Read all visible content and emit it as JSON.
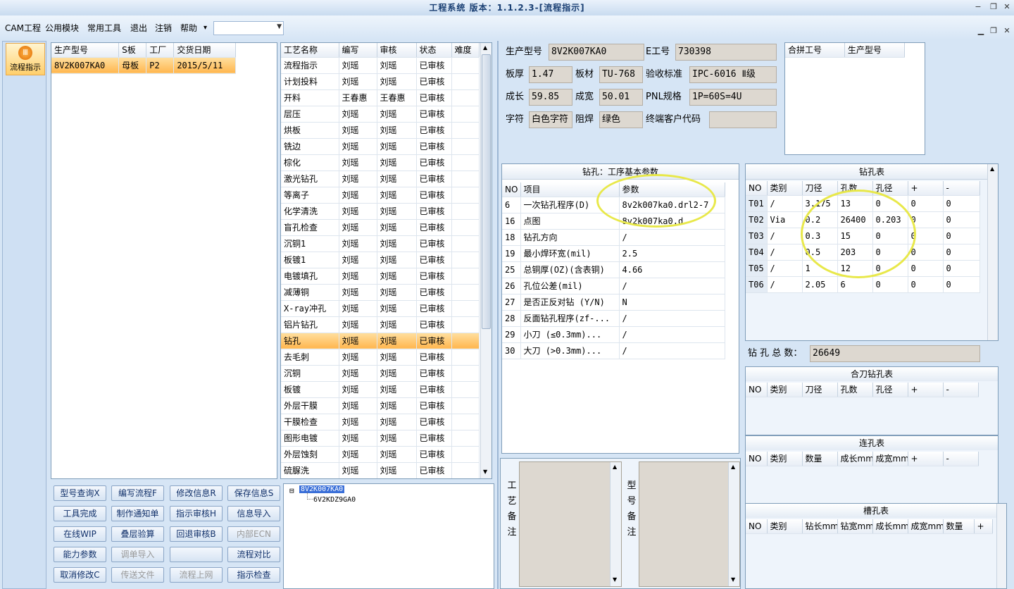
{
  "title": "工程系统 版本：1.1.2.3-[流程指示]",
  "menu": [
    "CAM工程",
    "公用模块",
    "常用工具",
    "退出",
    "注销",
    "帮助"
  ],
  "menu_arrow": "▾",
  "nav_button": "流程指示",
  "orders": {
    "headers": [
      "生产型号",
      "S板",
      "工厂",
      "交货日期"
    ],
    "rows": [
      [
        "8V2K007KA0",
        "母板",
        "P2",
        "2015/5/11"
      ]
    ]
  },
  "process": {
    "headers": [
      "工艺名称",
      "编写",
      "审核",
      "状态",
      "难度"
    ],
    "rows": [
      [
        "流程指示",
        "刘瑶",
        "刘瑶",
        "已审核",
        ""
      ],
      [
        "计划投料",
        "刘瑶",
        "刘瑶",
        "已审核",
        ""
      ],
      [
        "开料",
        "王春惠",
        "王春惠",
        "已审核",
        ""
      ],
      [
        "层压",
        "刘瑶",
        "刘瑶",
        "已审核",
        ""
      ],
      [
        "烘板",
        "刘瑶",
        "刘瑶",
        "已审核",
        ""
      ],
      [
        "铣边",
        "刘瑶",
        "刘瑶",
        "已审核",
        ""
      ],
      [
        "棕化",
        "刘瑶",
        "刘瑶",
        "已审核",
        ""
      ],
      [
        "激光钻孔",
        "刘瑶",
        "刘瑶",
        "已审核",
        ""
      ],
      [
        "等离子",
        "刘瑶",
        "刘瑶",
        "已审核",
        ""
      ],
      [
        "化学清洗",
        "刘瑶",
        "刘瑶",
        "已审核",
        ""
      ],
      [
        "盲孔检查",
        "刘瑶",
        "刘瑶",
        "已审核",
        ""
      ],
      [
        "沉铜1",
        "刘瑶",
        "刘瑶",
        "已审核",
        ""
      ],
      [
        "板镀1",
        "刘瑶",
        "刘瑶",
        "已审核",
        ""
      ],
      [
        "电镀填孔",
        "刘瑶",
        "刘瑶",
        "已审核",
        ""
      ],
      [
        "减薄铜",
        "刘瑶",
        "刘瑶",
        "已审核",
        ""
      ],
      [
        "X-ray冲孔",
        "刘瑶",
        "刘瑶",
        "已审核",
        ""
      ],
      [
        "铝片钻孔",
        "刘瑶",
        "刘瑶",
        "已审核",
        ""
      ],
      [
        "钻孔",
        "刘瑶",
        "刘瑶",
        "已审核",
        ""
      ],
      [
        "去毛刺",
        "刘瑶",
        "刘瑶",
        "已审核",
        ""
      ],
      [
        "沉铜",
        "刘瑶",
        "刘瑶",
        "已审核",
        ""
      ],
      [
        "板镀",
        "刘瑶",
        "刘瑶",
        "已审核",
        ""
      ],
      [
        "外层干膜",
        "刘瑶",
        "刘瑶",
        "已审核",
        ""
      ],
      [
        "干膜检查",
        "刘瑶",
        "刘瑶",
        "已审核",
        ""
      ],
      [
        "图形电镀",
        "刘瑶",
        "刘瑶",
        "已审核",
        ""
      ],
      [
        "外层蚀刻",
        "刘瑶",
        "刘瑶",
        "已审核",
        ""
      ],
      [
        "硫脲洗",
        "刘瑶",
        "刘瑶",
        "已审核",
        ""
      ]
    ],
    "selected_index": 17
  },
  "buttons": [
    [
      {
        "label": "型号查询X",
        "enabled": true
      },
      {
        "label": "编写流程F",
        "enabled": true
      },
      {
        "label": "修改信息R",
        "enabled": true
      },
      {
        "label": "保存信息S",
        "enabled": true
      }
    ],
    [
      {
        "label": "工具完成",
        "enabled": true
      },
      {
        "label": "制作通知单",
        "enabled": true
      },
      {
        "label": "指示审核H",
        "enabled": true
      },
      {
        "label": "信息导入",
        "enabled": true
      }
    ],
    [
      {
        "label": "在线WIP",
        "enabled": true
      },
      {
        "label": "叠层验算",
        "enabled": true
      },
      {
        "label": "回退审核B",
        "enabled": true
      },
      {
        "label": "内部ECN",
        "enabled": false
      }
    ],
    [
      {
        "label": "能力参数",
        "enabled": true
      },
      {
        "label": "调单导入",
        "enabled": false
      },
      {
        "label": "",
        "enabled": true
      },
      {
        "label": "流程对比",
        "enabled": true
      }
    ],
    [
      {
        "label": "取消修改C",
        "enabled": true
      },
      {
        "label": "传送文件",
        "enabled": false
      },
      {
        "label": "流程上网",
        "enabled": false
      },
      {
        "label": "指示检查",
        "enabled": true
      }
    ]
  ],
  "tree": {
    "root": "8V2K007KA0",
    "child": "6V2KDZ9GA0",
    "expander": "⊟"
  },
  "info": {
    "prod_model_label": "生产型号",
    "prod_model": "8V2K007KA0",
    "eng_label": "E工号",
    "eng": "730398",
    "thickness_label": "板厚",
    "thickness": "1.47",
    "material_label": "板材",
    "material": "TU-768",
    "standard_label": "验收标准",
    "standard": "IPC-6016 Ⅱ级",
    "length_label": "成长",
    "length": "59.85",
    "width_label": "成宽",
    "width": "50.01",
    "pnl_label": "PNL规格",
    "pnl": "1P=60S=4U",
    "char_label": "字符",
    "char": "白色字符",
    "mask_label": "阻焊",
    "mask": "绿色",
    "client_label": "终端客户代码",
    "client": ""
  },
  "combined": {
    "headers": [
      "合拼工号",
      "生产型号"
    ]
  },
  "drill_params": {
    "title": "钻孔：工序基本参数",
    "headers": [
      "NO",
      "项目",
      "参数"
    ],
    "rows": [
      [
        "6",
        "一次钻孔程序(D)",
        "8v2k007ka0.drl2-7"
      ],
      [
        "16",
        "点图",
        "8v2k007ka0.d"
      ],
      [
        "18",
        "钻孔方向",
        "/"
      ],
      [
        "19",
        "最小焊环宽(mil)",
        "2.5"
      ],
      [
        "25",
        "总铜厚(OZ)(含表铜)",
        "4.66"
      ],
      [
        "26",
        "孔位公差(mil)",
        "/"
      ],
      [
        "27",
        "是否正反对钻 (Y/N)",
        "N"
      ],
      [
        "28",
        "反面钻孔程序(zf-...",
        "/"
      ],
      [
        "29",
        "小刀 (≤0.3mm)...",
        "/"
      ],
      [
        "30",
        "大刀 (>0.3mm)...",
        "/"
      ]
    ]
  },
  "drill_table": {
    "title": "钻孔表",
    "headers": [
      "NO",
      "类别",
      "刀径",
      "孔数",
      "孔径",
      "+",
      "-"
    ],
    "rows": [
      [
        "T01",
        "/",
        "3.175",
        "13",
        "0",
        "0",
        "0"
      ],
      [
        "T02",
        "Via",
        "0.2",
        "26400",
        "0.203",
        "0",
        "0"
      ],
      [
        "T03",
        "/",
        "0.3",
        "15",
        "0",
        "0",
        "0"
      ],
      [
        "T04",
        "/",
        "0.5",
        "203",
        "0",
        "0",
        "0"
      ],
      [
        "T05",
        "/",
        "1",
        "12",
        "0",
        "0",
        "0"
      ],
      [
        "T06",
        "/",
        "2.05",
        "6",
        "0",
        "0",
        "0"
      ]
    ],
    "total_label": "钻 孔 总 数：",
    "total": "26649"
  },
  "merge_table": {
    "title": "合刀钻孔表",
    "headers": [
      "NO",
      "类别",
      "刀径",
      "孔数",
      "孔径",
      "+",
      "-"
    ]
  },
  "link_table": {
    "title": "连孔表",
    "headers": [
      "NO",
      "类别",
      "数量",
      "成长mm",
      "成宽mm",
      "+",
      "-"
    ]
  },
  "slot_table": {
    "title": "槽孔表",
    "headers": [
      "NO",
      "类别",
      "钻长mm",
      "钻宽mm",
      "成长mm",
      "成宽mm",
      "数量",
      "+"
    ]
  },
  "remarks": {
    "process_label": "工艺备注",
    "model_label": "型号备注"
  }
}
